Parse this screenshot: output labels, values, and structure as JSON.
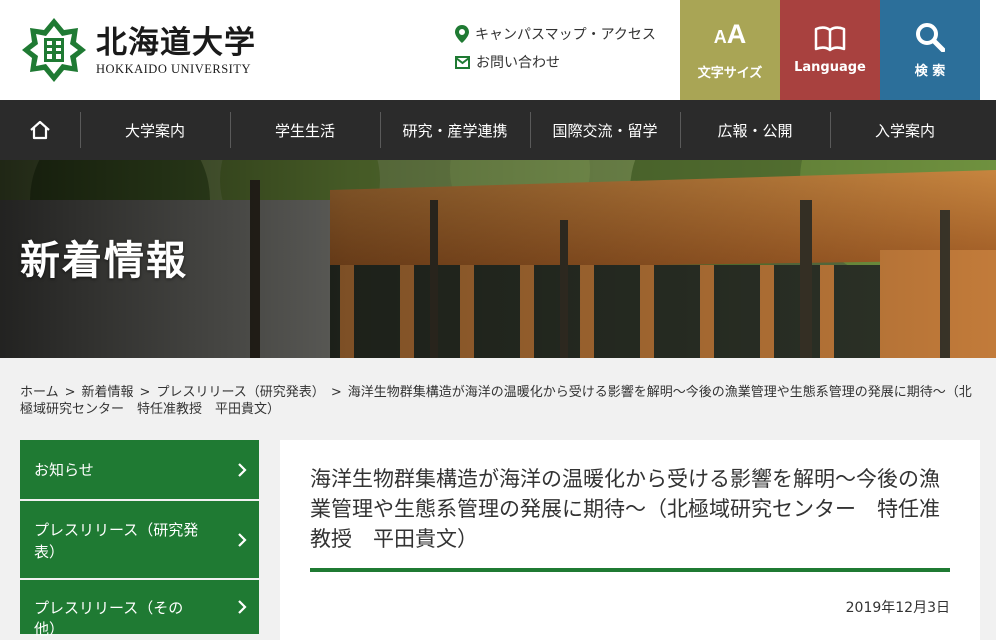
{
  "header": {
    "logo_jp": "北海道大学",
    "logo_en": "HOKKAIDO UNIVERSITY",
    "campus_map": "キャンパスマップ・アクセス",
    "contact": "お問い合わせ",
    "font_size_label": "文字サイズ",
    "font_size_glyph_small": "A",
    "font_size_glyph_large": "A",
    "language_label": "Language",
    "search_label": "検 索"
  },
  "nav": {
    "items": [
      "大学案内",
      "学生生活",
      "研究・産学連携",
      "国際交流・留学",
      "広報・公開",
      "入学案内"
    ]
  },
  "hero": {
    "title": "新着情報"
  },
  "breadcrumb": {
    "home": "ホーム",
    "news": "新着情報",
    "press": "プレスリリース（研究発表）",
    "current": "海洋生物群集構造が海洋の温暖化から受ける影響を解明〜今後の漁業管理や生態系管理の発展に期待〜（北極域研究センター　特任准教授　平田貴文）",
    "sep": ">"
  },
  "sidebar": {
    "items": [
      {
        "label": "お知らせ"
      },
      {
        "label": "プレスリリース（研究発表）"
      },
      {
        "label": "プレスリリース（その他）"
      }
    ]
  },
  "article": {
    "title": "海洋生物群集構造が海洋の温暖化から受ける影響を解明〜今後の漁業管理や生態系管理の発展に期待〜（北極域研究センター　特任准教授　平田貴文）",
    "date": "2019年12月3日"
  },
  "colors": {
    "green": "#1f7a33",
    "olive": "#a9a555",
    "red": "#a8413f",
    "blue": "#2c6f9a",
    "nav_bg": "#2b2b2b"
  }
}
